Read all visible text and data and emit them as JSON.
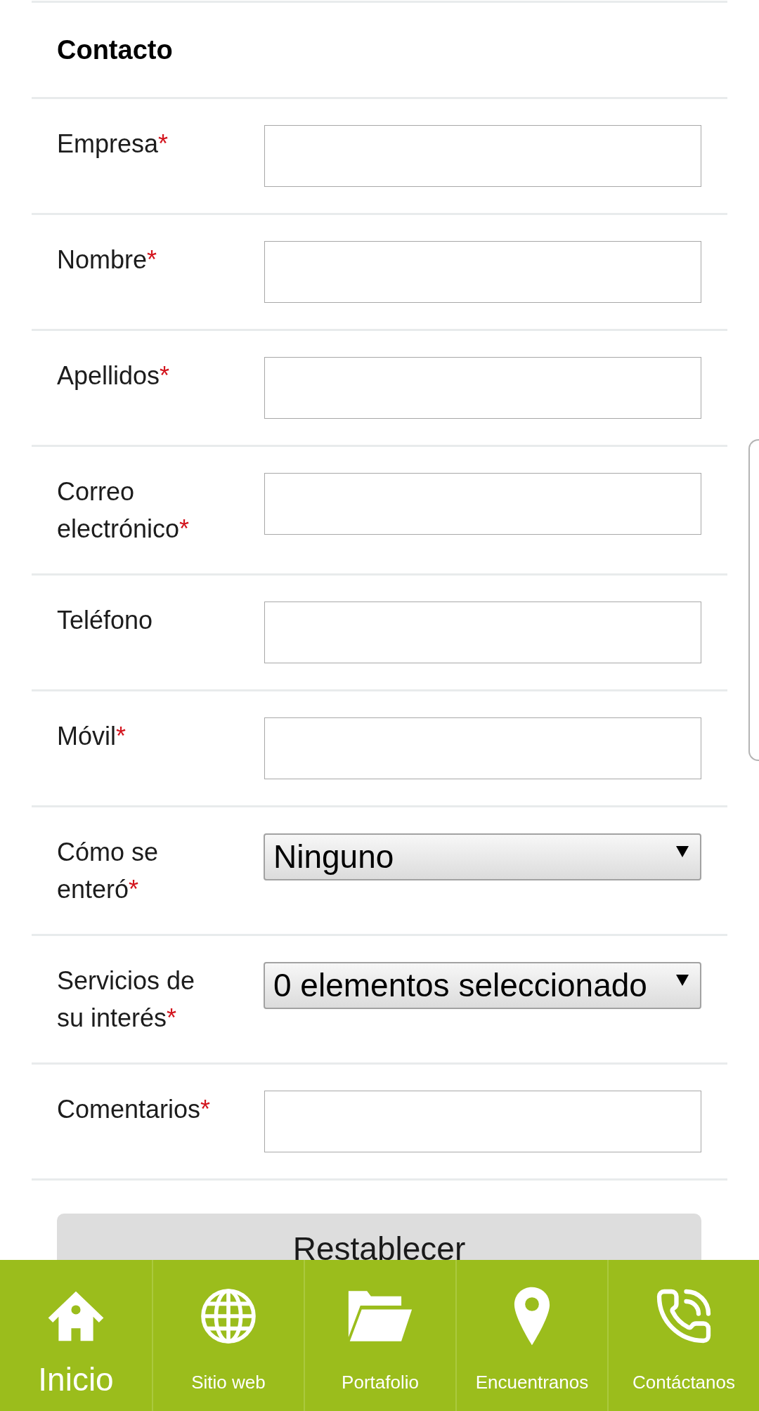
{
  "section": {
    "title": "Contacto"
  },
  "fields": [
    {
      "kind": "text",
      "label": "Empresa",
      "mark": "*"
    },
    {
      "kind": "text",
      "label": "Nombre",
      "mark": "*"
    },
    {
      "kind": "text",
      "label": "Apellidos",
      "mark": "*"
    },
    {
      "kind": "text",
      "label": "Correo electrónico",
      "mark": "*"
    },
    {
      "kind": "text",
      "label": "Teléfono"
    },
    {
      "kind": "text",
      "label": "Móvil",
      "mark": "*"
    },
    {
      "kind": "select",
      "label": "Cómo se enteró",
      "mark": "*",
      "value": "Ninguno"
    },
    {
      "kind": "select",
      "label": "Servicios de su interés",
      "mark": "*",
      "value": "0 elementos seleccionado"
    },
    {
      "kind": "text",
      "label": "Comentarios",
      "mark": "*"
    }
  ],
  "reset_button": {
    "label": "Restablecer"
  },
  "nav": [
    {
      "label": "Inicio",
      "selected": true
    },
    {
      "label": "Sitio web",
      "selected": false
    },
    {
      "label": "Portafolio",
      "selected": false
    },
    {
      "label": "Encuentranos",
      "selected": false
    },
    {
      "label": "Contáctanos",
      "selected": false
    }
  ]
}
